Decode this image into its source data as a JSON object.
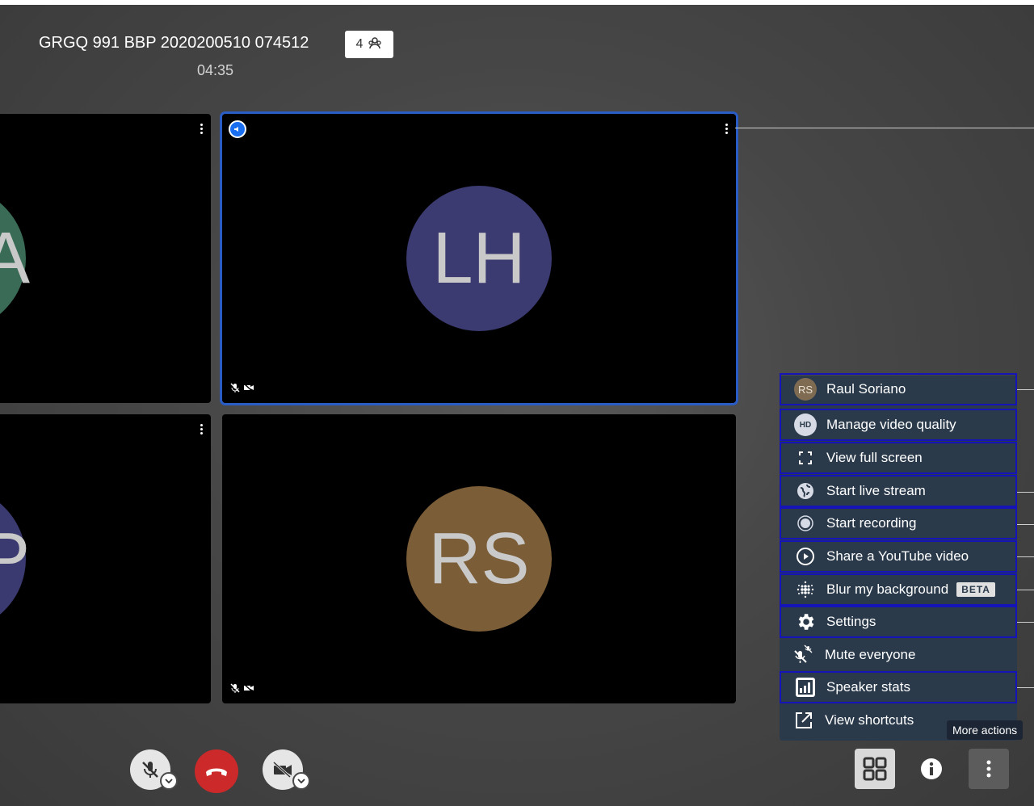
{
  "meeting": {
    "title": "GRGQ 991 BBP 2020200510 074512",
    "participant_count": "4",
    "timer": "04:35"
  },
  "tiles": {
    "left_top_initial": "A",
    "left_bottom_initial": "P",
    "lh_initials": "LH",
    "rs_initials": "RS"
  },
  "colors": {
    "lh_avatar": "#3b3a71",
    "rs_avatar": "#7b5d37",
    "left_top_avatar": "#3a6b56",
    "left_bottom_avatar": "#3a3a70",
    "active_border": "#2a5cc5",
    "menu_bg": "#2a3a4b",
    "hangup": "#cc2a2a"
  },
  "menu": {
    "user_initials": "RS",
    "hd_badge": "HD",
    "items": [
      {
        "label": "Raul Soriano",
        "icon": "avatar"
      },
      {
        "label": "Manage video quality",
        "icon": "hd-icon"
      },
      {
        "label": "View full screen",
        "icon": "fullscreen-icon"
      },
      {
        "label": "Start live stream",
        "icon": "globe-icon"
      },
      {
        "label": "Start recording",
        "icon": "record-icon"
      },
      {
        "label": "Share a YouTube video",
        "icon": "play-icon"
      },
      {
        "label": "Blur my background",
        "icon": "blur-icon",
        "badge": "BETA"
      },
      {
        "label": "Settings",
        "icon": "gear-icon"
      },
      {
        "label": "Mute everyone",
        "icon": "mute-everyone-icon"
      },
      {
        "label": "Speaker stats",
        "icon": "stats-icon"
      },
      {
        "label": "View shortcuts",
        "icon": "shortcut-icon"
      }
    ]
  },
  "tooltip": "More actions"
}
